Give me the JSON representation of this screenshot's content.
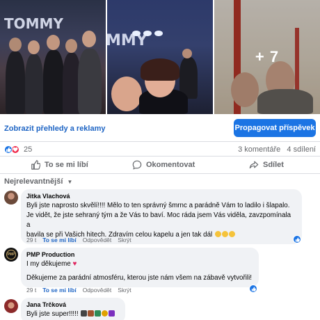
{
  "photos": {
    "more_count": "+ 7"
  },
  "toolbar": {
    "ads_link": "Zobrazit přehledy a reklamy",
    "promote_button": "Propagovat příspěvek"
  },
  "stats": {
    "reaction_count": "25",
    "comments": "3 komentáře",
    "shares": "4 sdílení",
    "reactions": [
      "like",
      "love"
    ]
  },
  "actions": {
    "like": "To se mi líbí",
    "comment": "Okomentovat",
    "share": "Sdílet"
  },
  "sort_label": "Nejrelevantnější",
  "comments": [
    {
      "author": "Jitka Vlachová",
      "lines": [
        "Byli jste naprosto skvělí!!!! Mělo to ten správný šmrnc a parádně Vám to ladilo i šlapalo.",
        "Je vidět, že jste sehraný tým a že Vás to baví. Moc ráda jsem Vás viděla, zavzpomínala a",
        "bavila se při Vašich hitech. Zdravím celou kapelu a jen tak dál"
      ],
      "time": "29 t",
      "like_label": "To se mi líbí",
      "reply_label": "Odpovědět",
      "hide_label": "Skrýt"
    },
    {
      "author": "PMP Production",
      "lines": [
        "I my děkujeme",
        "",
        "Děkujeme za parádní atmosféru, kterou jste nám všem na zábavě vytvořili!"
      ],
      "time": "29 t",
      "like_label": "To se mi líbí",
      "reply_label": "Odpovědět",
      "hide_label": "Skrýt",
      "avatar_text": "PMP"
    },
    {
      "author": "Jana Trčková",
      "lines": [
        "Byli jste super!!!!!"
      ]
    }
  ],
  "colors": {
    "accent": "#1b74e4",
    "link": "#1d64c4",
    "bubble": "#f0f2f5",
    "secondary_text": "#65676b"
  }
}
